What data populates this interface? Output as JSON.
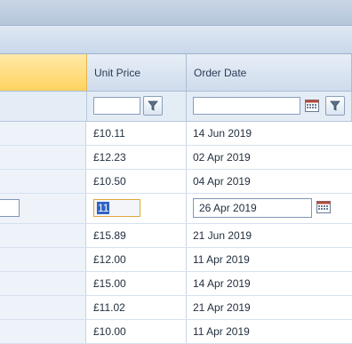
{
  "columns": [
    {
      "label": ""
    },
    {
      "label": "Unit Price"
    },
    {
      "label": "Order Date"
    }
  ],
  "filters": {
    "unit_price_value": "",
    "order_date_value": "",
    "filter_icon": "funnel-filter-icon",
    "calendar_icon": "calendar-icon"
  },
  "rows": [
    {
      "unit_price": "£10.11",
      "order_date": "14 Jun 2019"
    },
    {
      "unit_price": "£12.23",
      "order_date": "02 Apr 2019"
    },
    {
      "unit_price": "£10.50",
      "order_date": "04 Apr 2019"
    },
    {
      "unit_price": "11",
      "order_date": "26 Apr 2019",
      "editing": true
    },
    {
      "unit_price": "£15.89",
      "order_date": "21 Jun 2019"
    },
    {
      "unit_price": "£12.00",
      "order_date": "11 Apr 2019"
    },
    {
      "unit_price": "£15.00",
      "order_date": "14 Apr 2019"
    },
    {
      "unit_price": "£11.02",
      "order_date": "21 Apr 2019"
    },
    {
      "unit_price": "£10.00",
      "order_date": "11 Apr 2019"
    }
  ],
  "colors": {
    "header_selected": "#ffd35f",
    "selection": "#2f63c4",
    "header": "#cfdcec"
  }
}
